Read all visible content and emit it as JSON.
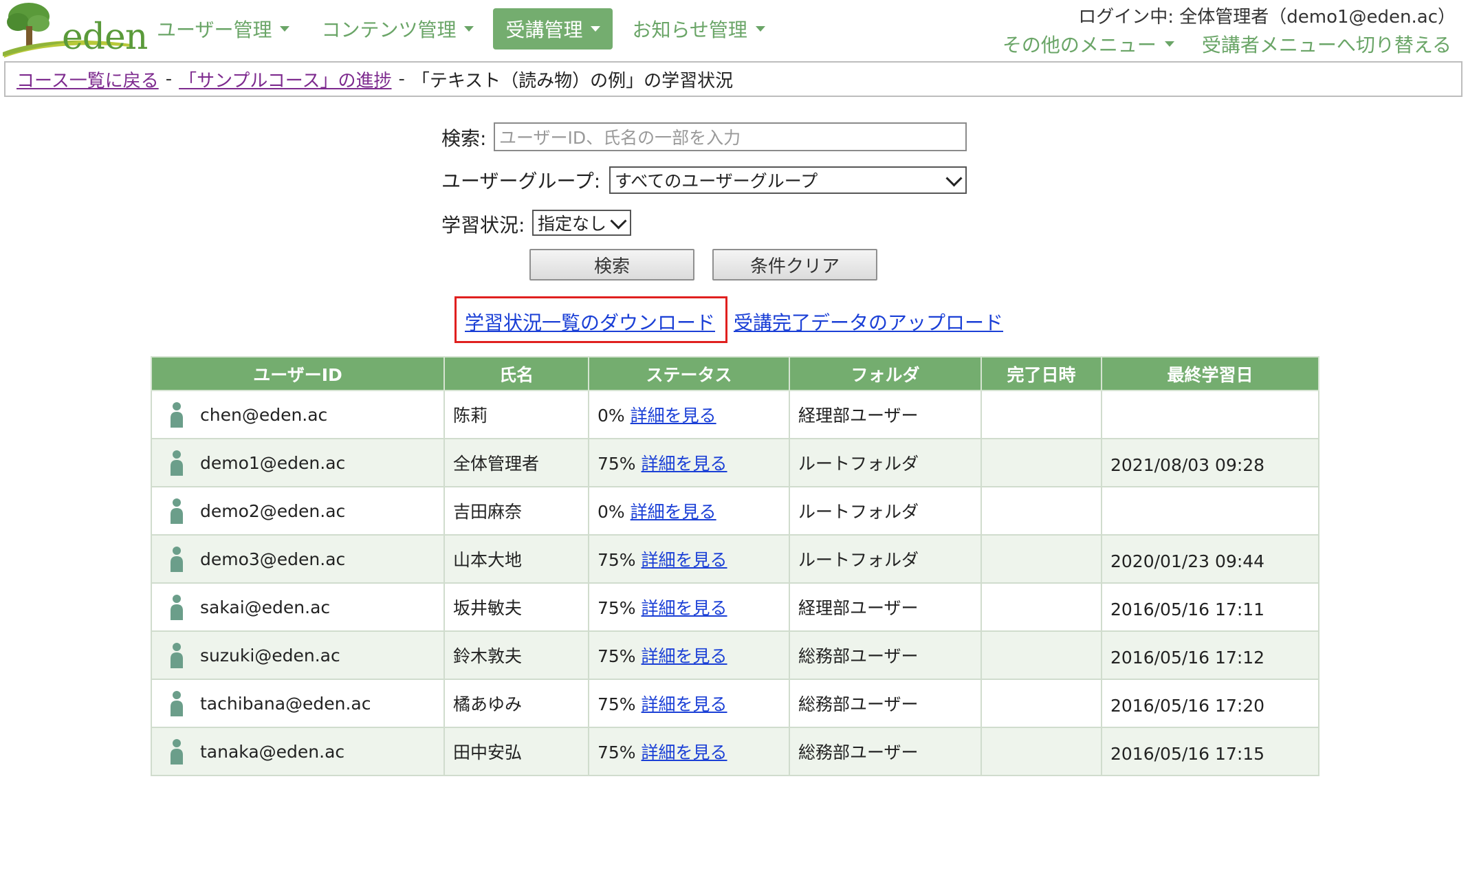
{
  "logo": {
    "text": "eden",
    "icon": "tree-logo-icon"
  },
  "nav": {
    "items": [
      {
        "label": "ユーザー管理",
        "active": false
      },
      {
        "label": "コンテンツ管理",
        "active": false
      },
      {
        "label": "受講管理",
        "active": true
      },
      {
        "label": "お知らせ管理",
        "active": false
      }
    ]
  },
  "header": {
    "login_info": "ログイン中: 全体管理者（demo1@eden.ac）",
    "other_menu": "その他のメニュー",
    "switch_menu": "受講者メニューへ切り替える"
  },
  "breadcrumb": {
    "back_to_courses": "コース一覧に戻る",
    "sep": "-",
    "course_progress": "「サンプルコース」の進捗",
    "current": "「テキスト（読み物）の例」の学習状況"
  },
  "search": {
    "label": "検索:",
    "placeholder": "ユーザーID、氏名の一部を入力",
    "group_label": "ユーザーグループ:",
    "group_value": "すべてのユーザーグループ",
    "status_label": "学習状況:",
    "status_value": "指定なし",
    "search_button": "検索",
    "clear_button": "条件クリア"
  },
  "links": {
    "download": "学習状況一覧のダウンロード",
    "upload": "受講完了データのアップロード"
  },
  "colors": {
    "accent": "#74ad6f",
    "link": "#1a3fd6",
    "highlight": "#e0201f",
    "visited": "#7d2a8e"
  },
  "table": {
    "headers": [
      "ユーザーID",
      "氏名",
      "ステータス",
      "フォルダ",
      "完了日時",
      "最終学習日"
    ],
    "detail_label": "詳細を見る",
    "rows": [
      {
        "user_id": "chen@eden.ac",
        "name": "陈莉",
        "progress": "0%",
        "folder": "経理部ユーザー",
        "completed": "",
        "last_study": ""
      },
      {
        "user_id": "demo1@eden.ac",
        "name": "全体管理者",
        "progress": "75%",
        "folder": "ルートフォルダ",
        "completed": "",
        "last_study": "2021/08/03 09:28"
      },
      {
        "user_id": "demo2@eden.ac",
        "name": "吉田麻奈",
        "progress": "0%",
        "folder": "ルートフォルダ",
        "completed": "",
        "last_study": ""
      },
      {
        "user_id": "demo3@eden.ac",
        "name": "山本大地",
        "progress": "75%",
        "folder": "ルートフォルダ",
        "completed": "",
        "last_study": "2020/01/23 09:44"
      },
      {
        "user_id": "sakai@eden.ac",
        "name": "坂井敏夫",
        "progress": "75%",
        "folder": "経理部ユーザー",
        "completed": "",
        "last_study": "2016/05/16 17:11"
      },
      {
        "user_id": "suzuki@eden.ac",
        "name": "鈴木敦夫",
        "progress": "75%",
        "folder": "総務部ユーザー",
        "completed": "",
        "last_study": "2016/05/16 17:12"
      },
      {
        "user_id": "tachibana@eden.ac",
        "name": "橘あゆみ",
        "progress": "75%",
        "folder": "総務部ユーザー",
        "completed": "",
        "last_study": "2016/05/16 17:20"
      },
      {
        "user_id": "tanaka@eden.ac",
        "name": "田中安弘",
        "progress": "75%",
        "folder": "総務部ユーザー",
        "completed": "",
        "last_study": "2016/05/16 17:15"
      }
    ]
  }
}
